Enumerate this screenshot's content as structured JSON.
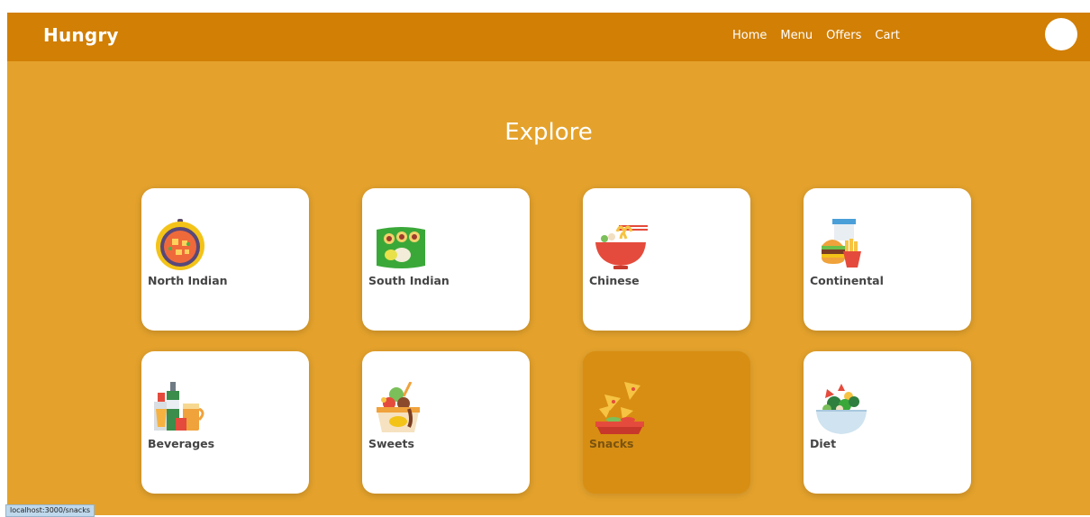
{
  "navbar": {
    "brand": "Hungry",
    "links": [
      "Home",
      "Menu",
      "Offers",
      "Cart"
    ]
  },
  "title": "Explore",
  "categories": [
    {
      "label": "North Indian",
      "icon": "curry-pot-icon"
    },
    {
      "label": "South Indian",
      "icon": "banana-leaf-meal-icon"
    },
    {
      "label": "Chinese",
      "icon": "noodle-bowl-icon"
    },
    {
      "label": "Continental",
      "icon": "burger-fries-icon"
    },
    {
      "label": "Beverages",
      "icon": "bottles-drinks-icon"
    },
    {
      "label": "Sweets",
      "icon": "dessert-cup-icon"
    },
    {
      "label": "Snacks",
      "icon": "nachos-icon"
    },
    {
      "label": "Diet",
      "icon": "salad-bowl-icon"
    }
  ],
  "hovered_category": "Snacks",
  "status_bar": "localhost:3000/snacks",
  "colors": {
    "page_background": "#e4a22c",
    "navbar": "#d17f05",
    "card": "#ffffff",
    "card_hovered": "#d88e12"
  }
}
